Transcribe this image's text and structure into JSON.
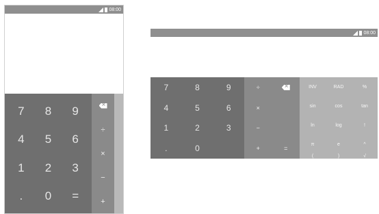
{
  "portrait": {
    "status_time": "08:00",
    "digit_keys": [
      "7",
      "8",
      "9",
      "4",
      "5",
      "6",
      "1",
      "2",
      "3",
      ".",
      "0",
      "="
    ],
    "op_keys": [
      "÷",
      "×",
      "−",
      "+"
    ]
  },
  "landscape": {
    "status_time": "08:00",
    "digit_keys": [
      "7",
      "8",
      "9",
      "4",
      "5",
      "6",
      "1",
      "2",
      "3",
      ".",
      "0",
      ""
    ],
    "op_keys": [
      "÷",
      "",
      "×",
      "",
      "−",
      "",
      "+",
      "="
    ],
    "sci_keys": [
      "INV",
      "RAD",
      "%",
      "sin",
      "cos",
      "tan",
      "ln",
      "log",
      "!",
      "π",
      "e",
      "^",
      "(",
      ")",
      "√"
    ]
  }
}
